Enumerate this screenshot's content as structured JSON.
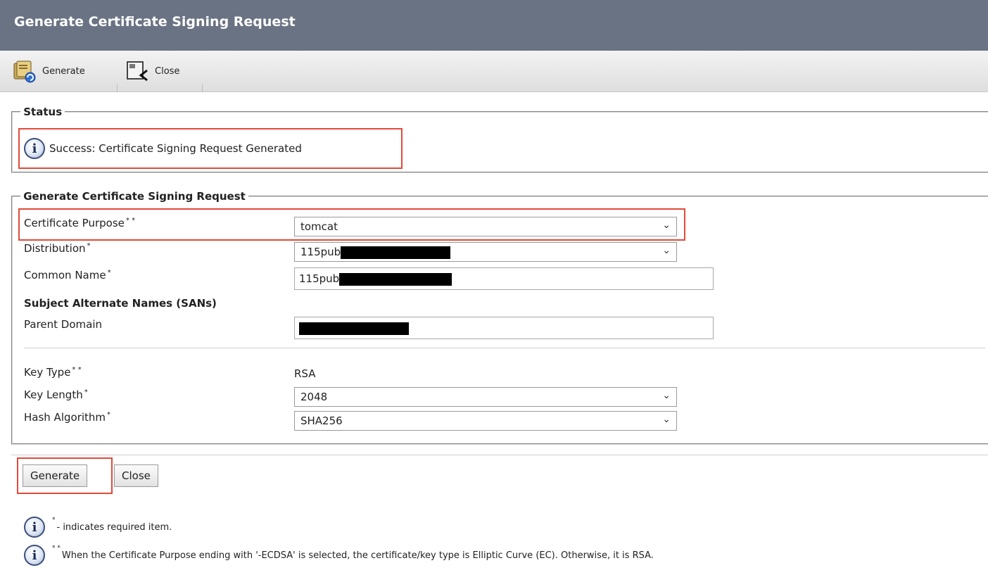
{
  "window": {
    "title": "Generate Certificate Signing Request"
  },
  "toolbar": {
    "generate_label": "Generate",
    "close_label": "Close"
  },
  "status": {
    "legend": "Status",
    "message": "Success: Certificate Signing Request Generated"
  },
  "form": {
    "legend": "Generate Certificate Signing Request",
    "certificate_purpose": {
      "label": "Certificate Purpose",
      "required_mark": "* *",
      "value": "tomcat"
    },
    "distribution": {
      "label": "Distribution",
      "required_mark": "*",
      "value": "115pub"
    },
    "common_name": {
      "label": "Common Name",
      "required_mark": "*",
      "value": "115pub"
    },
    "sans_heading": "Subject Alternate Names (SANs)",
    "parent_domain": {
      "label": "Parent Domain",
      "value": ""
    },
    "key_type": {
      "label": "Key Type",
      "required_mark": "* *",
      "value": "RSA"
    },
    "key_length": {
      "label": "Key Length",
      "required_mark": "*",
      "value": "2048"
    },
    "hash_algorithm": {
      "label": "Hash Algorithm",
      "required_mark": "*",
      "value": "SHA256"
    }
  },
  "buttons": {
    "generate_label": "Generate",
    "close_label": "Close"
  },
  "notes": {
    "required_marker": "*",
    "required_text": "- indicates required item.",
    "ecdsa_marker": "* *",
    "ecdsa_text": "When the Certificate Purpose ending with '-ECDSA' is selected, the certificate/key type is Elliptic Curve (EC). Otherwise, it is RSA."
  },
  "colors": {
    "titlebar": "#6a7383",
    "highlight": "#e24a3a",
    "info_icon": "#3c4f7a"
  },
  "icons": {
    "generate": "generate-csr-icon",
    "close": "close-window-icon",
    "info": "info-icon",
    "dropdown": "chevron-down-icon"
  }
}
